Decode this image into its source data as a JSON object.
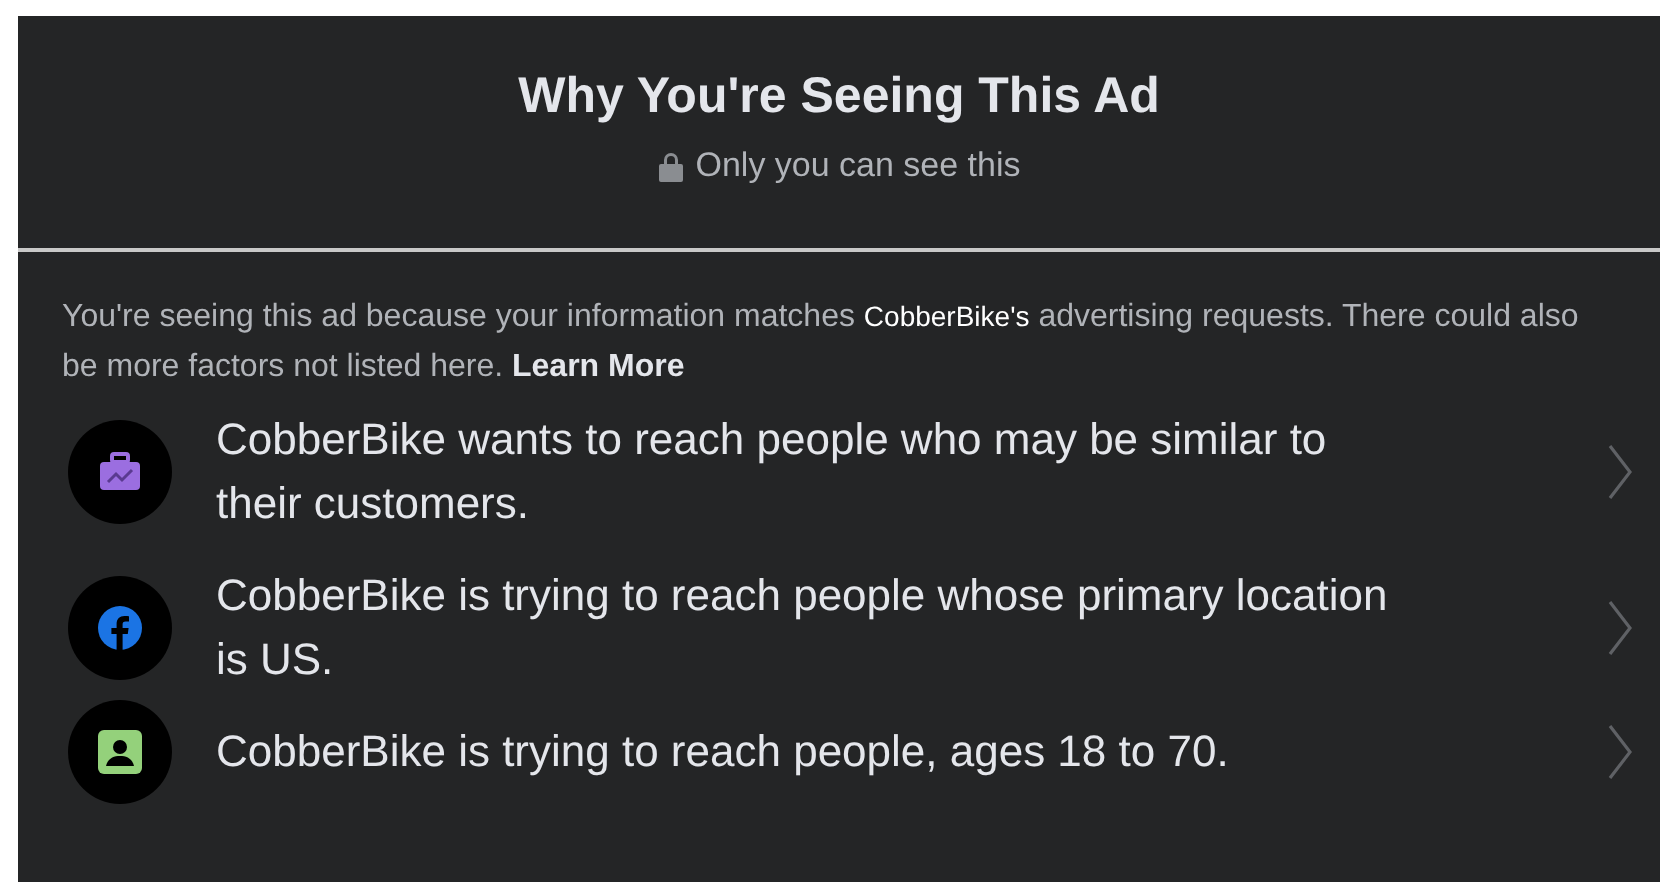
{
  "header": {
    "title": "Why You're Seeing This Ad",
    "privacy": "Only you can see this"
  },
  "intro": {
    "text_before": "You're seeing this ad because your information matches",
    "advertiser": "CobberBike's",
    "text_after": "advertising requests. There could also be more factors not listed here.",
    "link": "Learn More"
  },
  "reasons": [
    {
      "kind": "similar",
      "text": "CobberBike wants to reach people who may be similar to their customers."
    },
    {
      "kind": "location",
      "text": "CobberBike is trying to reach people whose primary location is US."
    },
    {
      "kind": "age",
      "text": "CobberBike is trying to reach people, ages 18 to 70."
    }
  ]
}
